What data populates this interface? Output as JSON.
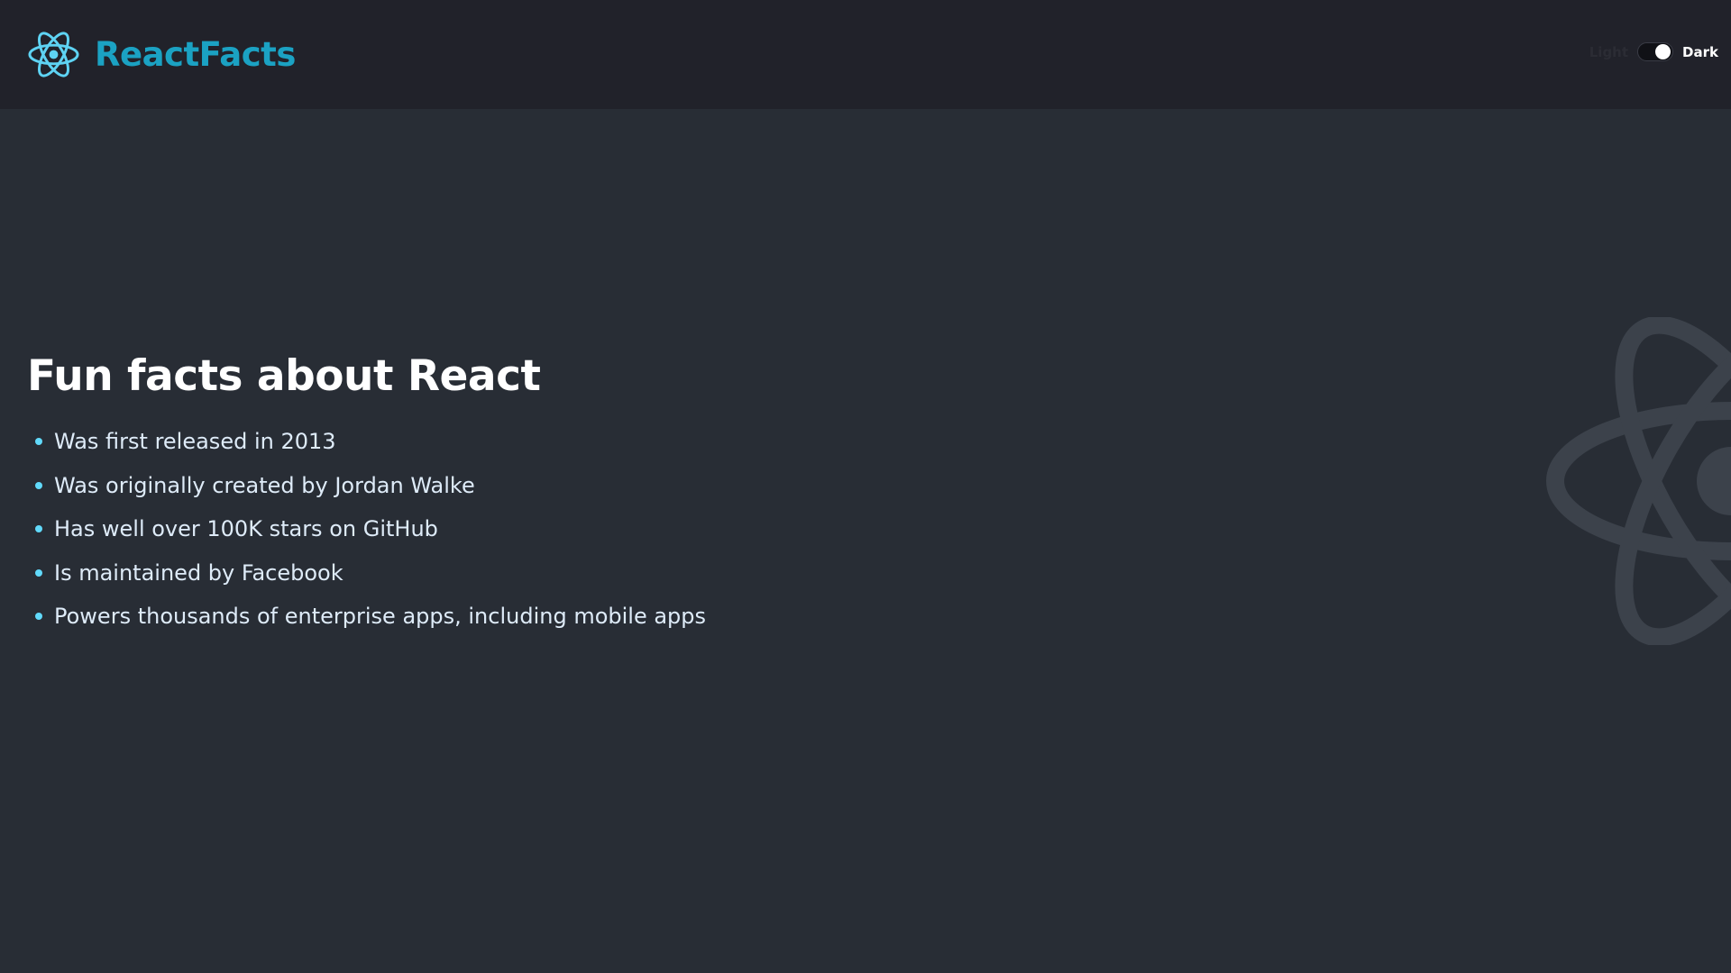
{
  "header": {
    "brand_title": "ReactFacts",
    "logo_icon": "react-atom-icon",
    "theme_toggle": {
      "light_label": "Light",
      "dark_label": "Dark",
      "selected": "Dark"
    }
  },
  "main": {
    "title": "Fun facts about React",
    "facts": [
      "Was first released in 2013",
      "Was originally created by Jordan Walke",
      "Has well over 100K stars on GitHub",
      "Is maintained by Facebook",
      "Powers thousands of enterprise apps, including mobile apps"
    ]
  },
  "background_icon": "react-atom-watermark-icon",
  "colors": {
    "navbar_bg": "#21222a",
    "page_bg": "#282d35",
    "brand": "#1ba2c3",
    "bullet": "#61dafb",
    "text": "#deebf8"
  }
}
